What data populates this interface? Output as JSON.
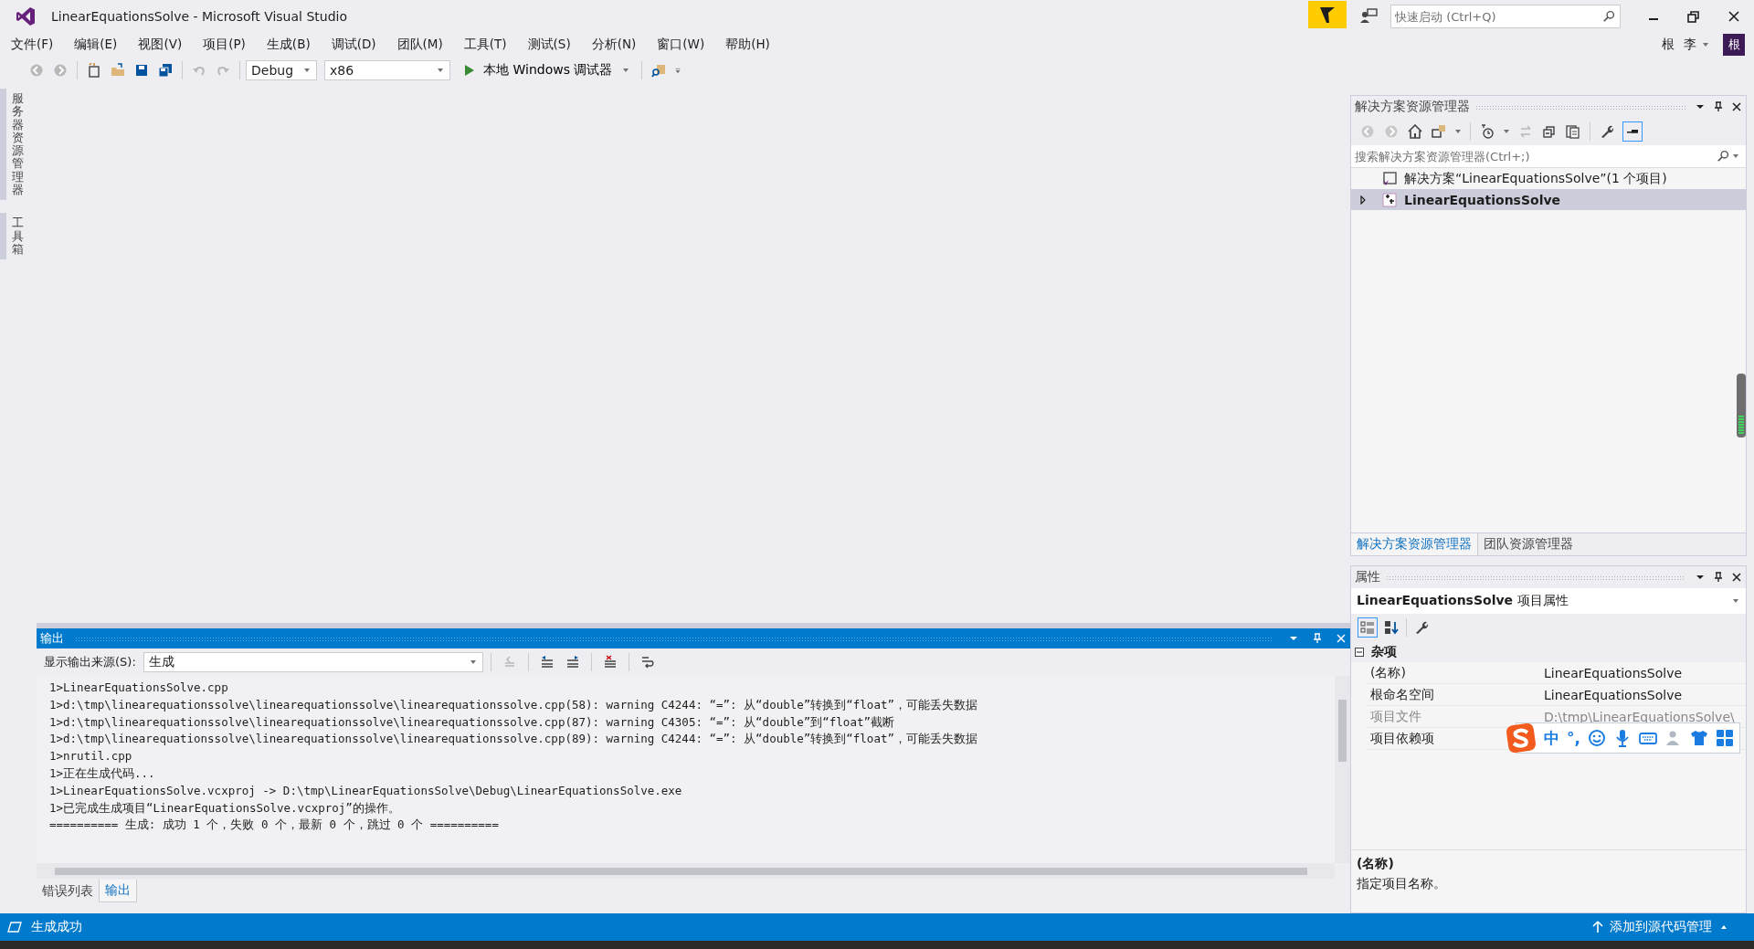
{
  "window": {
    "title": "LinearEquationsSolve - Microsoft Visual Studio",
    "quick_launch": {
      "placeholder": "快速启动 (Ctrl+Q)"
    },
    "user": "根 李",
    "avatar": "根"
  },
  "menu": [
    "文件(F)",
    "编辑(E)",
    "视图(V)",
    "项目(P)",
    "生成(B)",
    "调试(D)",
    "团队(M)",
    "工具(T)",
    "测试(S)",
    "分析(N)",
    "窗口(W)",
    "帮助(H)"
  ],
  "toolbar": {
    "configuration": "Debug",
    "platform": "x86",
    "run_target": "本地 Windows 调试器"
  },
  "side_tabs": [
    "服务器资源管理器",
    "工具箱"
  ],
  "solution_explorer": {
    "title": "解决方案资源管理器",
    "search": {
      "placeholder": "搜索解决方案资源管理器(Ctrl+;)"
    },
    "tree": [
      {
        "label": "解决方案“LinearEquationsSolve”(1 个项目)",
        "kind": "solution",
        "selected": false,
        "children": [
          {
            "label": "LinearEquationsSolve",
            "kind": "project",
            "selected": true,
            "expanded": false
          }
        ]
      }
    ],
    "tabs": [
      {
        "label": "解决方案资源管理器",
        "selected": true
      },
      {
        "label": "团队资源管理器",
        "selected": false
      }
    ]
  },
  "properties": {
    "title": "属性",
    "object": "LinearEquationsSolve",
    "object_type": "项目属性",
    "category": {
      "label": "杂项",
      "expanded": true
    },
    "rows": [
      {
        "name": "(名称)",
        "value": "LinearEquationsSolve",
        "disabled": false
      },
      {
        "name": "根命名空间",
        "value": "LinearEquationsSolve",
        "disabled": false
      },
      {
        "name": "项目文件",
        "value": "D:\\tmp\\LinearEquationsSolve\\",
        "disabled": true
      },
      {
        "name": "项目依赖项",
        "disabled": false
      }
    ],
    "description_title": "(名称)",
    "description": "指定项目名称。"
  },
  "ime_toolbar": {
    "mode": "中",
    "punctuation": "°,"
  },
  "output": {
    "title": "输出",
    "source_label": "显示输出来源(S):",
    "source": "生成",
    "lines": [
      "1>LinearEquationsSolve.cpp",
      "1>d:\\tmp\\linearequationssolve\\linearequationssolve\\linearequationssolve.cpp(58): warning C4244: “=”: 从“double”转换到“float”，可能丢失数据",
      "1>d:\\tmp\\linearequationssolve\\linearequationssolve\\linearequationssolve.cpp(87): warning C4305: “=”: 从“double”到“float”截断",
      "1>d:\\tmp\\linearequationssolve\\linearequationssolve\\linearequationssolve.cpp(89): warning C4244: “=”: 从“double”转换到“float”，可能丢失数据",
      "1>nrutil.cpp",
      "1>正在生成代码...",
      "1>LinearEquationsSolve.vcxproj -> D:\\tmp\\LinearEquationsSolve\\Debug\\LinearEquationsSolve.exe",
      "1>已完成生成项目“LinearEquationsSolve.vcxproj”的操作。",
      "========== 生成: 成功 1 个，失败 0 个，最新 0 个，跳过 0 个 =========="
    ],
    "tabs": [
      {
        "label": "错误列表",
        "selected": false
      },
      {
        "label": "输出",
        "selected": true
      }
    ]
  },
  "status_bar": {
    "message": "生成成功",
    "source_control": "添加到源代码管理"
  }
}
